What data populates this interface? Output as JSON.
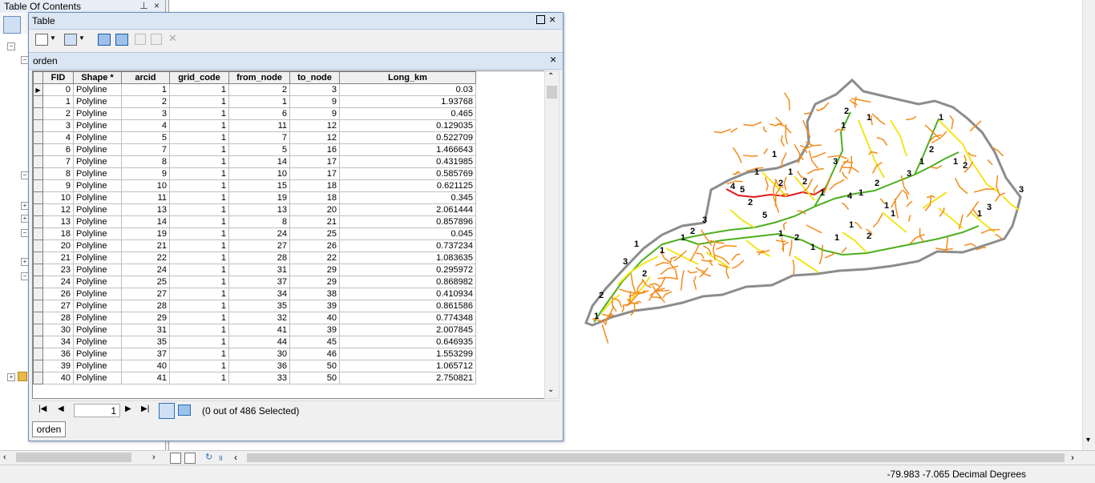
{
  "toc": {
    "title": "Table Of Contents",
    "pin": "ᵖ",
    "close": "×"
  },
  "table_window": {
    "title": "Table",
    "tab_name": "orden",
    "columns": [
      "FID",
      "Shape *",
      "arcid",
      "grid_code",
      "from_node",
      "to_node",
      "Long_km"
    ],
    "rows": [
      [
        "0",
        "Polyline",
        "1",
        "1",
        "2",
        "3",
        "0.03"
      ],
      [
        "1",
        "Polyline",
        "2",
        "1",
        "1",
        "9",
        "1.93768"
      ],
      [
        "2",
        "Polyline",
        "3",
        "1",
        "6",
        "9",
        "0.465"
      ],
      [
        "3",
        "Polyline",
        "4",
        "1",
        "11",
        "12",
        "0.129035"
      ],
      [
        "4",
        "Polyline",
        "5",
        "1",
        "7",
        "12",
        "0.522709"
      ],
      [
        "6",
        "Polyline",
        "7",
        "1",
        "5",
        "16",
        "1.466643"
      ],
      [
        "7",
        "Polyline",
        "8",
        "1",
        "14",
        "17",
        "0.431985"
      ],
      [
        "8",
        "Polyline",
        "9",
        "1",
        "10",
        "17",
        "0.585769"
      ],
      [
        "9",
        "Polyline",
        "10",
        "1",
        "15",
        "18",
        "0.621125"
      ],
      [
        "10",
        "Polyline",
        "11",
        "1",
        "19",
        "18",
        "0.345"
      ],
      [
        "12",
        "Polyline",
        "13",
        "1",
        "13",
        "20",
        "2.061444"
      ],
      [
        "13",
        "Polyline",
        "14",
        "1",
        "8",
        "21",
        "0.857896"
      ],
      [
        "18",
        "Polyline",
        "19",
        "1",
        "24",
        "25",
        "0.045"
      ],
      [
        "20",
        "Polyline",
        "21",
        "1",
        "27",
        "26",
        "0.737234"
      ],
      [
        "21",
        "Polyline",
        "22",
        "1",
        "28",
        "22",
        "1.083635"
      ],
      [
        "23",
        "Polyline",
        "24",
        "1",
        "31",
        "29",
        "0.295972"
      ],
      [
        "24",
        "Polyline",
        "25",
        "1",
        "37",
        "29",
        "0.868982"
      ],
      [
        "26",
        "Polyline",
        "27",
        "1",
        "34",
        "38",
        "0.410934"
      ],
      [
        "27",
        "Polyline",
        "28",
        "1",
        "35",
        "39",
        "0.861586"
      ],
      [
        "28",
        "Polyline",
        "29",
        "1",
        "32",
        "40",
        "0.774348"
      ],
      [
        "30",
        "Polyline",
        "31",
        "1",
        "41",
        "39",
        "2.007845"
      ],
      [
        "34",
        "Polyline",
        "35",
        "1",
        "44",
        "45",
        "0.646935"
      ],
      [
        "36",
        "Polyline",
        "37",
        "1",
        "30",
        "46",
        "1.553299"
      ],
      [
        "39",
        "Polyline",
        "40",
        "1",
        "36",
        "50",
        "1.065712"
      ],
      [
        "40",
        "Polyline",
        "41",
        "1",
        "33",
        "50",
        "2.750821"
      ]
    ],
    "record_number": "1",
    "selection_status": "(0 out of 486 Selected)",
    "bottom_tab": "orden"
  },
  "status_bar": {
    "coordinates": "-79.983  -7.065 Decimal Degrees"
  },
  "map": {
    "colors": {
      "outline": "#8c8c8c",
      "order1": "#f28a1a",
      "order2": "#f4e51d",
      "order3": "#4caf1e",
      "order4": "#e31a1c"
    },
    "labels": [
      "1",
      "2",
      "3",
      "1",
      "2",
      "1",
      "1",
      "2",
      "3",
      "4",
      "5",
      "2",
      "1",
      "1",
      "2",
      "1",
      "2",
      "1",
      "3",
      "1",
      "2",
      "4",
      "1",
      "1",
      "2",
      "1",
      "1",
      "3",
      "1",
      "2",
      "1",
      "1",
      "2",
      "1",
      "3",
      "5",
      "1",
      "2",
      "1",
      "1",
      "1",
      "2",
      "3"
    ]
  }
}
